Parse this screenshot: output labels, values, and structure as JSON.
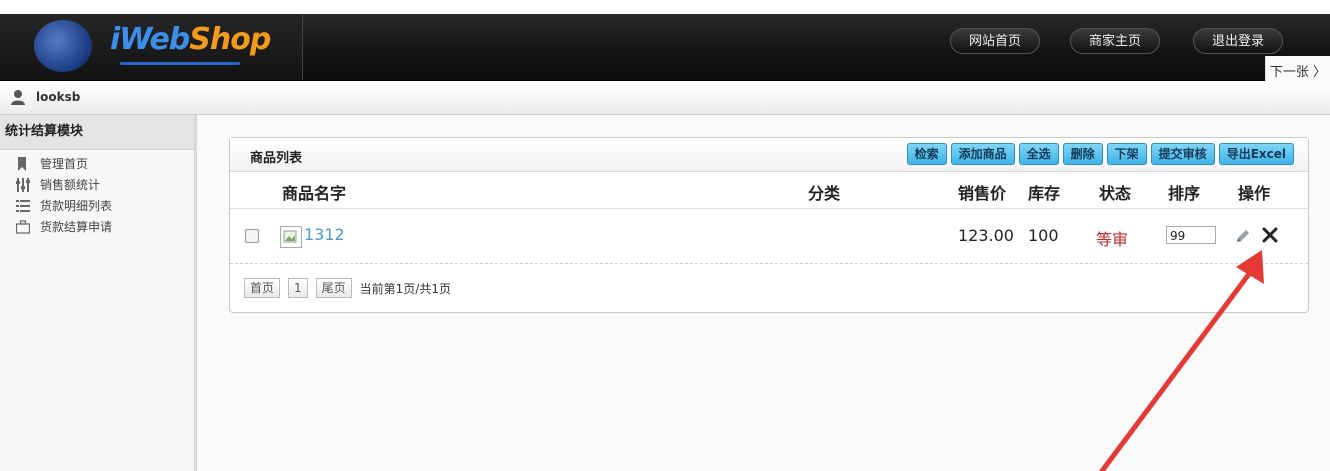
{
  "app": {
    "logo_part1": "iWeb",
    "logo_part2": "Shop"
  },
  "topnav": {
    "home": "网站首页",
    "merchant_home": "商家主页",
    "logout": "退出登录"
  },
  "next_tab": "下一张 〉",
  "user": {
    "name": "looksb"
  },
  "sidebar": {
    "title": "统计结算模块",
    "items": [
      {
        "label": "管理首页",
        "icon": "bookmark-icon"
      },
      {
        "label": "销售额统计",
        "icon": "sliders-icon"
      },
      {
        "label": "货款明细列表",
        "icon": "list-icon"
      },
      {
        "label": "货款结算申请",
        "icon": "briefcase-icon"
      }
    ]
  },
  "panel": {
    "title": "商品列表",
    "buttons": [
      "检索",
      "添加商品",
      "全选",
      "删除",
      "下架",
      "提交审核",
      "导出Excel"
    ],
    "columns": [
      "商品名字",
      "分类",
      "销售价",
      "库存",
      "状态",
      "排序",
      "操作"
    ],
    "rows": [
      {
        "name": "1312",
        "category": "",
        "price": "123.00",
        "stock": "100",
        "status": "等审",
        "sort": "99"
      }
    ],
    "pager": {
      "first": "首页",
      "page": "1",
      "last": "尾页",
      "info": "当前第1页/共1页"
    }
  },
  "colors": {
    "accent_button": "#3fb2e6",
    "status_red": "#c62828",
    "link": "#4a9cc9",
    "arrow": "#e53935"
  }
}
